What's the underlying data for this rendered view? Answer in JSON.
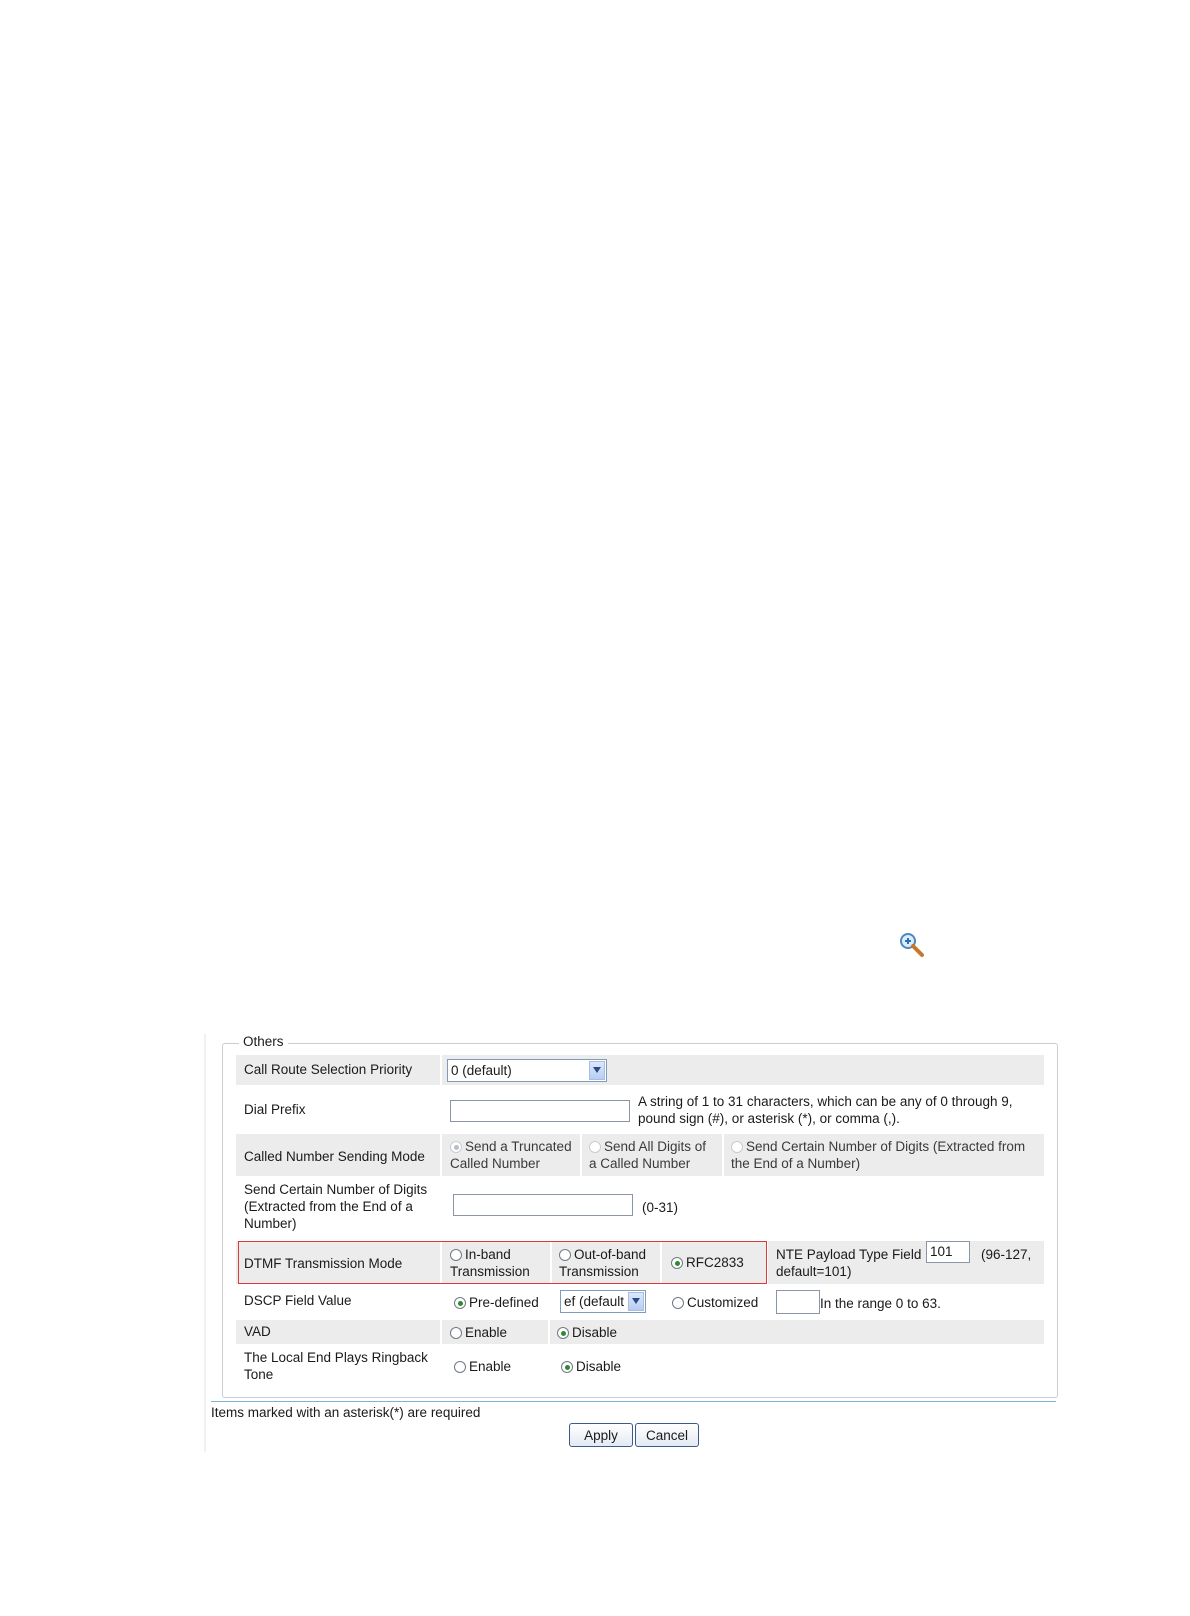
{
  "toolbar": {
    "zoom_icon": "zoom-in-magnifier-icon"
  },
  "others": {
    "legend": "Others",
    "call_route": {
      "label": "Call Route Selection Priority",
      "value": "0 (default)"
    },
    "dial_prefix": {
      "label": "Dial Prefix",
      "value": "",
      "hint_line1": "A string of 1 to 31 characters, which can be any of 0 through 9,",
      "hint_line2": "pound sign (#), or asterisk (*), or comma (,)."
    },
    "called_number": {
      "label": "Called Number Sending Mode",
      "opt1_line1": "Send a Truncated",
      "opt1_line2": "Called Number",
      "opt2_line1": "Send All Digits of",
      "opt2_line2": "a Called Number",
      "opt3_line1": "Send Certain Number of Digits (Extracted from",
      "opt3_line2": "the End of a Number)"
    },
    "send_certain": {
      "label_line1": "Send Certain Number of Digits",
      "label_line2": "(Extracted from the End of a",
      "label_line3": "Number)",
      "value": "",
      "range": "(0-31)"
    },
    "dtmf": {
      "label": "DTMF Transmission Mode",
      "opt1_line1": "In-band",
      "opt1_line2": "Transmission",
      "opt2_line1": "Out-of-band",
      "opt2_line2": "Transmission",
      "opt3": "RFC2833",
      "nte_label": "NTE Payload Type Field",
      "nte_value": "101",
      "nte_range_line1": "(96-127,",
      "nte_range_line2": "default=101)"
    },
    "dscp": {
      "label": "DSCP Field Value",
      "predefined": "Pre-defined",
      "select_value": "ef (default",
      "customized": "Customized",
      "custom_value": "",
      "range": "In the range 0 to 63."
    },
    "vad": {
      "label": "VAD",
      "enable": "Enable",
      "disable": "Disable"
    },
    "ringback": {
      "label_line1": "The Local End Plays Ringback",
      "label_line2": "Tone",
      "enable": "Enable",
      "disable": "Disable"
    }
  },
  "footer": {
    "required_note": "Items marked with an asterisk(*) are required",
    "apply": "Apply",
    "cancel": "Cancel"
  }
}
